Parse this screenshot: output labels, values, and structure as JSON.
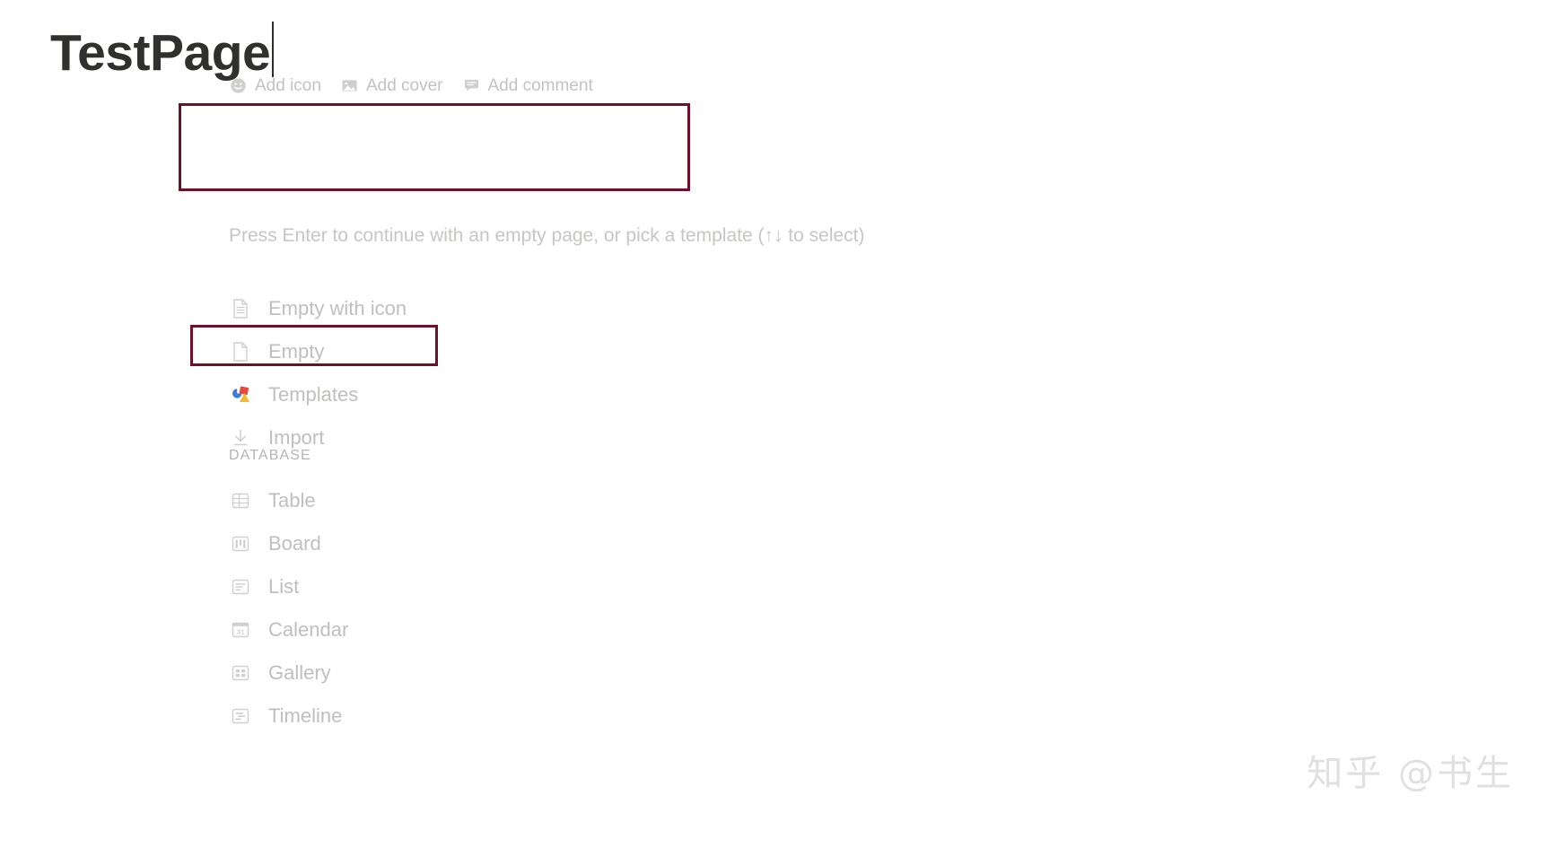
{
  "colors": {
    "highlight_border": "#6E1028",
    "muted_text": "#BFBFBD",
    "title_text": "#30302E",
    "watermark": "#E0E0E0",
    "templates_blue": "#3D7FD4",
    "templates_red": "#E8483F",
    "templates_yellow": "#F2B92C"
  },
  "action_bar": {
    "items": [
      {
        "label": "Add icon",
        "icon": "smiley-face-icon"
      },
      {
        "label": "Add cover",
        "icon": "image-icon"
      },
      {
        "label": "Add comment",
        "icon": "comment-bubble-icon"
      }
    ]
  },
  "title": {
    "value": "TestPage",
    "placeholder": "Untitled",
    "caret_visible": true
  },
  "hint": {
    "text": "Press Enter to continue with an empty page, or pick a template (↑↓ to select)"
  },
  "menu": {
    "items": [
      {
        "label": "Empty with icon",
        "icon": "document-lines-icon",
        "selected": false
      },
      {
        "label": "Empty",
        "icon": "document-blank-icon",
        "selected": true
      },
      {
        "label": "Templates",
        "icon": "templates-shapes-icon",
        "selected": false
      },
      {
        "label": "Import",
        "icon": "download-arrow-icon",
        "selected": false
      }
    ]
  },
  "database_section": {
    "heading": "DATABASE",
    "items": [
      {
        "label": "Table",
        "icon": "table-grid-icon"
      },
      {
        "label": "Board",
        "icon": "board-columns-icon"
      },
      {
        "label": "List",
        "icon": "list-lines-icon"
      },
      {
        "label": "Calendar",
        "icon": "calendar-31-icon",
        "icon_text": "31"
      },
      {
        "label": "Gallery",
        "icon": "gallery-tiles-icon"
      },
      {
        "label": "Timeline",
        "icon": "timeline-bars-icon"
      }
    ]
  },
  "watermark": {
    "text": "知乎 @书生"
  }
}
